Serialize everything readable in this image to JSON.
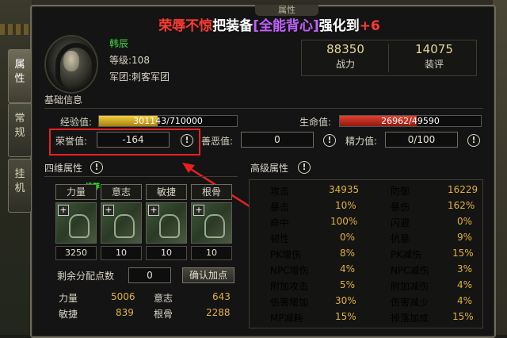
{
  "window": {
    "title": "属性"
  },
  "banner": {
    "part1": "荣辱不惊",
    "part2": "把装备",
    "part3": "[全能背心]",
    "part4": "强化到",
    "part5": "+6"
  },
  "tabs": [
    {
      "label_a": "属",
      "label_b": "性"
    },
    {
      "label_a": "常",
      "label_b": "规"
    },
    {
      "label_a": "挂",
      "label_b": "机"
    }
  ],
  "character": {
    "name": "韩辰",
    "level": "等级:108",
    "guild": "军团:刺客军团"
  },
  "stats": {
    "power_value": "88350",
    "power_label": "战力",
    "equip_value": "14075",
    "equip_label": "装评"
  },
  "basic": {
    "title": "基础信息",
    "exp_label": "经验值:",
    "exp_value": "301143/710000",
    "exp_fraction": 0.424,
    "hp_label": "生命值:",
    "hp_value": "26962/49590",
    "hp_fraction": 0.544,
    "honor_label": "荣誉值:",
    "honor_value": "-164",
    "good_label": "善恶值:",
    "good_value": "0",
    "energy_label": "精力值:",
    "energy_value": "0/100"
  },
  "four": {
    "title": "四维属性",
    "tag": "推荐",
    "cols": [
      {
        "head": "力量",
        "value": "3250"
      },
      {
        "head": "意志",
        "value": "10"
      },
      {
        "head": "敏捷",
        "value": "10"
      },
      {
        "head": "根骨",
        "value": "10"
      }
    ],
    "remaining_label": "剩余分配点数",
    "remaining_value": "0",
    "confirm_button": "确认加点",
    "summary": [
      {
        "k1": "力量",
        "v1": "5006",
        "k2": "意志",
        "v2": "643"
      },
      {
        "k1": "敏捷",
        "v1": "839",
        "k2": "根骨",
        "v2": "2288"
      }
    ]
  },
  "advanced": {
    "title": "高级属性",
    "rows": [
      {
        "k1": "攻击",
        "v1": "34935",
        "k2": "防御",
        "v2": "16229"
      },
      {
        "k1": "暴击",
        "v1": "10%",
        "k2": "暴伤",
        "v2": "162%"
      },
      {
        "k1": "命中",
        "v1": "100%",
        "k2": "闪避",
        "v2": "0%"
      },
      {
        "k1": "韧性",
        "v1": "0%",
        "k2": "抗暴",
        "v2": "9%"
      },
      {
        "k1": "PK增伤",
        "v1": "8%",
        "k2": "PK减伤",
        "v2": "15%"
      },
      {
        "k1": "NPC增伤",
        "v1": "4%",
        "k2": "NPC减伤",
        "v2": "3%"
      },
      {
        "k1": "附加攻击",
        "v1": "5%",
        "k2": "附加减伤",
        "v2": "4%"
      },
      {
        "k1": "伤害增加",
        "v1": "30%",
        "k2": "伤害减少",
        "v2": "4%"
      },
      {
        "k1": "MP减耗",
        "v1": "15%",
        "k2": "掉落加成",
        "v2": "15%"
      }
    ]
  },
  "colors": {
    "name": "#46d046",
    "value": "#e0b040",
    "highlight": "#e82020",
    "exp_bar": "#d0b020",
    "hp_bar": "#c02820"
  }
}
